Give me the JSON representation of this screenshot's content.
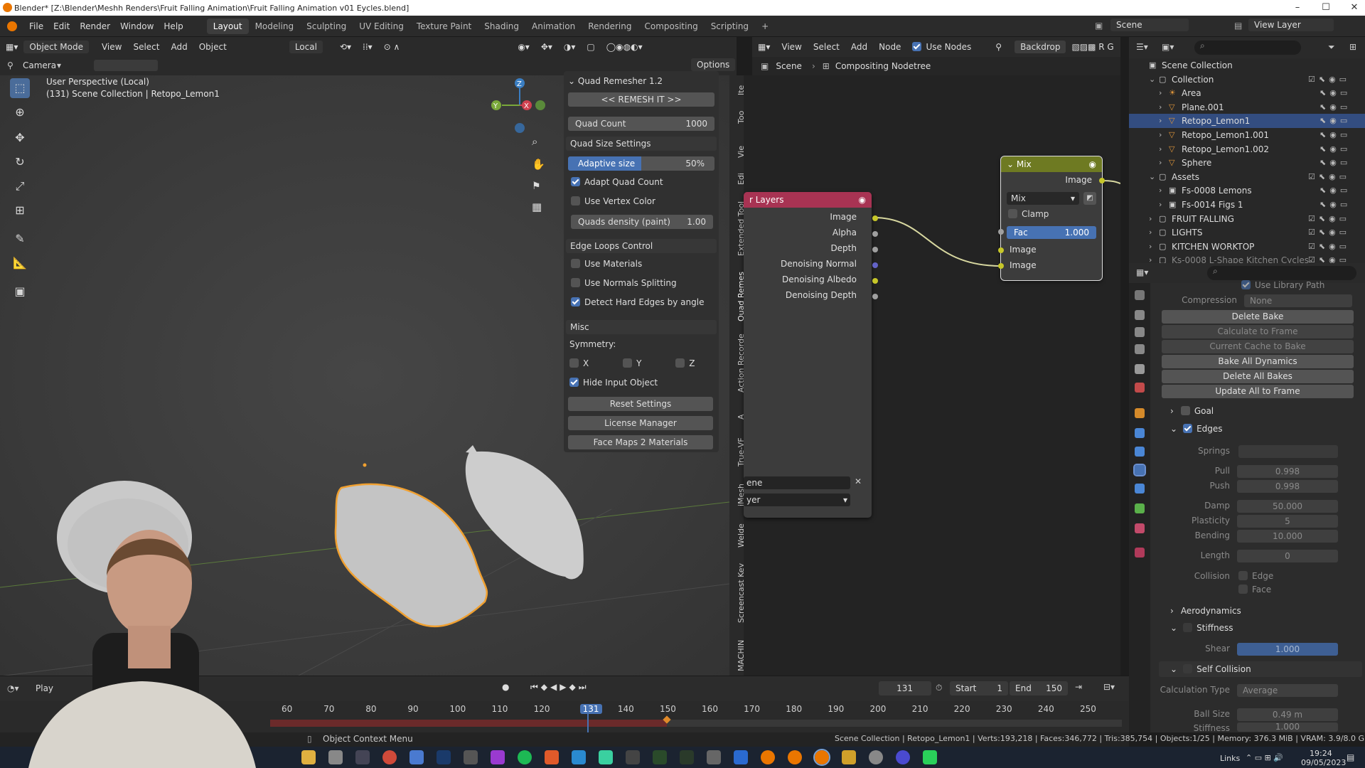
{
  "window": {
    "title": "Blender* [Z:\\Blender\\Meshh Renders\\Fruit Falling Animation\\Fruit Falling Animation v01 Eycles.blend]"
  },
  "menu": [
    "File",
    "Edit",
    "Render",
    "Window",
    "Help"
  ],
  "workspaces": [
    "Layout",
    "Modeling",
    "Sculpting",
    "UV Editing",
    "Texture Paint",
    "Shading",
    "Animation",
    "Rendering",
    "Compositing",
    "Scripting"
  ],
  "scene_selector": {
    "scene": "Scene",
    "view_layer": "View Layer"
  },
  "viewport": {
    "mode": "Object Mode",
    "menus": [
      "View",
      "Select",
      "Add",
      "Object"
    ],
    "orientation": "Local",
    "camera": "Camera",
    "options": "Options",
    "info_line1": "User Perspective (Local)",
    "info_line2": "(131) Scene Collection | Retopo_Lemon1",
    "gizmo": {
      "x": "X",
      "y": "Y",
      "z": "Z"
    }
  },
  "quad_remesher": {
    "title": "Quad Remesher 1.2",
    "remesh_button": "<< REMESH IT >>",
    "quad_count_label": "Quad Count",
    "quad_count_value": "1000",
    "size_settings": "Quad Size Settings",
    "adaptive_label": "Adaptive size",
    "adaptive_value": "50%",
    "adaptive_fraction": 0.5,
    "adapt_quad_count": "Adapt Quad Count",
    "use_vertex_color": "Use Vertex Color",
    "density_label": "Quads density (paint)",
    "density_value": "1.00",
    "edge_loops": "Edge Loops Control",
    "use_materials": "Use Materials",
    "use_normals": "Use Normals Splitting",
    "detect_hard": "Detect Hard Edges by angle",
    "misc": "Misc",
    "symmetry": "Symmetry:",
    "sym_x": "X",
    "sym_y": "Y",
    "sym_z": "Z",
    "hide_input": "Hide Input Object",
    "reset": "Reset Settings",
    "license": "License Manager",
    "face_maps": "Face Maps 2 Materials"
  },
  "side_tabs": [
    "Ite",
    "Too",
    "Vie",
    "Edi",
    "Extended Tool",
    "Quad Remes",
    "Action Recorde",
    "A",
    "True-VF",
    "iMesh",
    "Welde",
    "Screencast Key",
    "MACHIN"
  ],
  "node_editor": {
    "menus": [
      "View",
      "Select",
      "Add",
      "Node"
    ],
    "use_nodes": "Use Nodes",
    "backdrop": "Backdrop",
    "breadcrumb_scene": "Scene",
    "breadcrumb_tree": "Compositing Nodetree",
    "render_layers": {
      "title": "r Layers",
      "outputs": [
        "Image",
        "Alpha",
        "Depth",
        "Denoising Normal",
        "Denoising Albedo",
        "Denoising Depth"
      ],
      "scene_field": "ene",
      "layer_field": "yer"
    },
    "mix": {
      "title": "Mix",
      "output": "Image",
      "blend": "Mix",
      "clamp": "Clamp",
      "fac_label": "Fac",
      "fac_value": "1.000",
      "input1": "Image",
      "input2": "Image"
    }
  },
  "outliner": {
    "rows": [
      {
        "label": "Scene Collection",
        "indent": 0
      },
      {
        "label": "Collection",
        "indent": 1
      },
      {
        "label": "Area",
        "indent": 2
      },
      {
        "label": "Plane.001",
        "indent": 2
      },
      {
        "label": "Retopo_Lemon1",
        "indent": 2,
        "selected": true
      },
      {
        "label": "Retopo_Lemon1.001",
        "indent": 2
      },
      {
        "label": "Retopo_Lemon1.002",
        "indent": 2
      },
      {
        "label": "Sphere",
        "indent": 2
      },
      {
        "label": "Assets",
        "indent": 1
      },
      {
        "label": "Fs-0008 Lemons",
        "indent": 2
      },
      {
        "label": "Fs-0014 Figs 1",
        "indent": 2
      },
      {
        "label": "FRUIT FALLING",
        "indent": 1
      },
      {
        "label": "LIGHTS",
        "indent": 1
      },
      {
        "label": "KITCHEN WORKTOP",
        "indent": 1
      },
      {
        "label": "Ks-0008 L-Shape Kitchen Cycles",
        "indent": 1
      }
    ]
  },
  "properties": {
    "use_library_path": "Use Library Path",
    "compression_label": "Compression",
    "compression_value": "None",
    "buttons": [
      "Delete Bake",
      "Calculate to Frame",
      "Current Cache to Bake",
      "Bake All Dynamics",
      "Delete All Bakes",
      "Update All to Frame"
    ],
    "goal": "Goal",
    "edges": "Edges",
    "springs": "Springs",
    "pull_label": "Pull",
    "pull": "0.998",
    "push_label": "Push",
    "push": "0.998",
    "damp_label": "Damp",
    "damp": "50.000",
    "plasticity_label": "Plasticity",
    "plasticity": "5",
    "bending_label": "Bending",
    "bending": "10.000",
    "length_label": "Length",
    "length": "0",
    "collision_label": "Collision",
    "collision_edge": "Edge",
    "collision_face": "Face",
    "aerodynamics": "Aerodynamics",
    "stiffness": "Stiffness",
    "shear_label": "Shear",
    "shear": "1.000",
    "self_collision": "Self Collision",
    "calc_type_label": "Calculation Type",
    "calc_type": "Average",
    "ball_size_label": "Ball Size",
    "ball_size": "0.49 m",
    "stiffness_label": "Stiffness",
    "stiffness_value": "1.000"
  },
  "timeline": {
    "playback": "Play",
    "current_frame": "131",
    "start_label": "Start",
    "start": "1",
    "end_label": "End",
    "end": "150",
    "ticks": [
      "60",
      "70",
      "80",
      "90",
      "100",
      "110",
      "120",
      "131",
      "140",
      "150",
      "160",
      "170",
      "180",
      "190",
      "200",
      "210",
      "220",
      "230",
      "240",
      "250"
    ]
  },
  "statusbar": {
    "left": "Object Context Menu",
    "right": "Scene Collection | Retopo_Lemon1 | Verts:193,218 | Faces:346,772 | Tris:385,754 | Objects:1/25 | Memory: 376.3 MiB | VRAM: 3.9/8.0 GiB | 3.5.1"
  },
  "taskbar": {
    "links": "Links",
    "time": "19:24",
    "date": "09/05/2023"
  },
  "colors": {
    "accent": "#4772b3",
    "selection_outline": "#f0a030",
    "render_layers_header": "#a83353",
    "mix_header": "#6e7a22",
    "socket_yellow": "#c7c729",
    "socket_purple": "#6363c7"
  }
}
